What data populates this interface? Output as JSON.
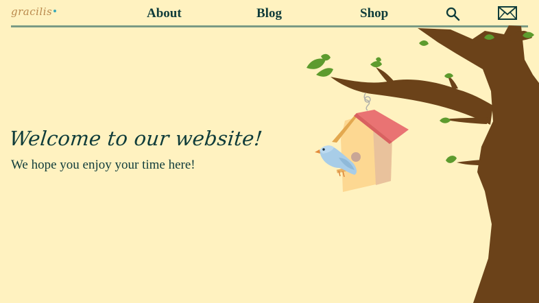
{
  "brand": {
    "logo_text": "gracilis"
  },
  "nav": {
    "items": [
      {
        "label": "About"
      },
      {
        "label": "Blog"
      },
      {
        "label": "Shop"
      }
    ],
    "icons": [
      "search-icon",
      "mail-icon"
    ]
  },
  "hero": {
    "title": "Welcome to our website!",
    "subtitle": "We hope you enjoy your time here!"
  },
  "colors": {
    "background": "#fff2c0",
    "text": "#0f3c3a",
    "nav_rule": "#7a9a84",
    "tree_brown": "#6b4219",
    "leaf_green": "#5d9b2e",
    "birdhouse_roof": "#e97373",
    "birdhouse_body": "#fdd892",
    "bird_blue": "#a8cde8"
  }
}
